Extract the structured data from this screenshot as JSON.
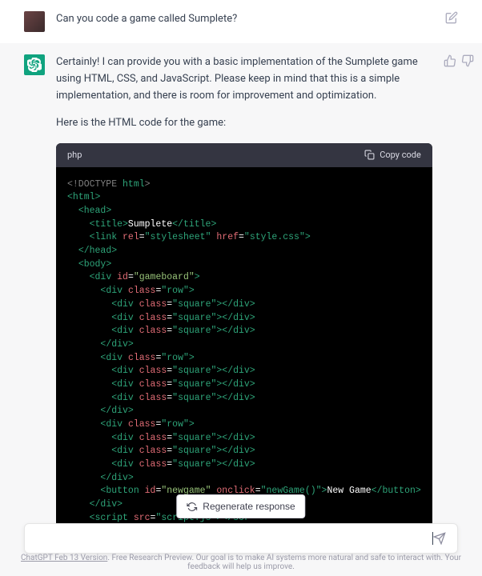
{
  "user_message": "Can you code a game called Sumplete?",
  "assistant_intro_1": "Certainly! I can provide you with a basic implementation of the Sumplete game using HTML, CSS, and JavaScript. Please keep in mind that this is a simple implementation, and there is room for improvement and optimization.",
  "assistant_intro_2": "Here is the HTML code for the game:",
  "code_lang": "php",
  "copy_label": "Copy code",
  "regen_label": "Regenerate response",
  "footer_version": "ChatGPT Feb 13 Version",
  "footer_rest": ". Free Research Preview. Our goal is to make AI systems more natural and safe to interact with. Your feedback will help us improve.",
  "code": {
    "title_text": "Sumplete",
    "stylesheet_href": "style.css",
    "gameboard_id": "gameboard",
    "row_class": "row",
    "square_class": "square",
    "newgame_id": "newgame",
    "newgame_onclick": "newGame()",
    "newgame_text": "New Game",
    "script_src": "script.js"
  }
}
